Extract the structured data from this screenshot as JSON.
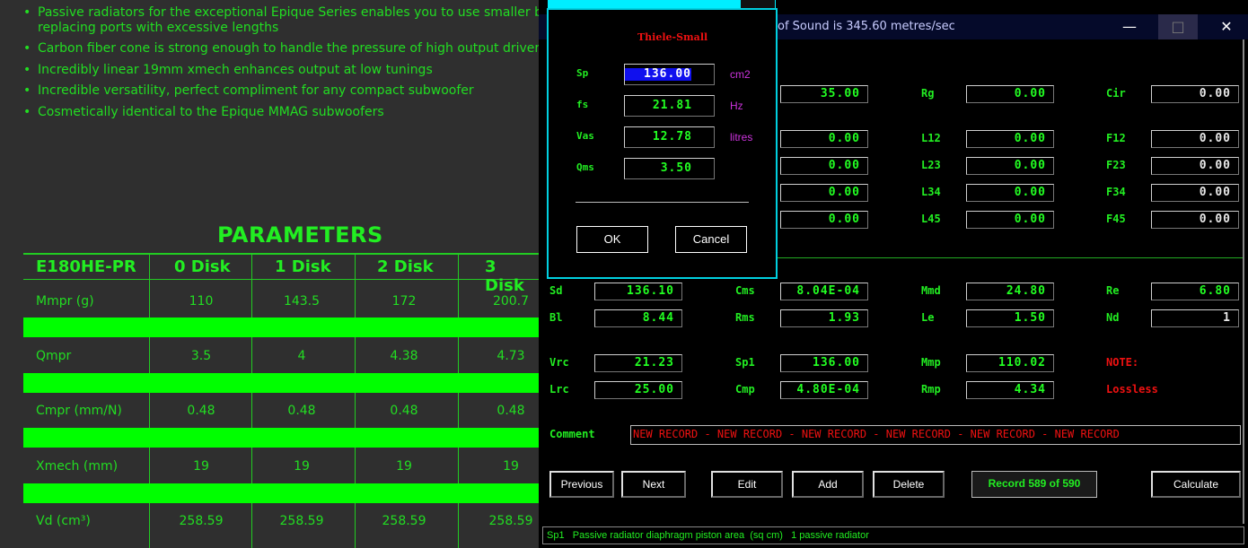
{
  "web": {
    "bullets": [
      "Passive radiators for the exceptional Epique Series enables you to use smaller boxes",
      "replacing ports with excessive lengths",
      "Carbon fiber cone is strong enough to handle the pressure of high output drivers",
      "Incredibly linear 19mm xmech enhances output at low tunings",
      "Incredible versatility, perfect compliment for any compact subwoofer",
      "Cosmetically identical to the Epique MMAG subwoofers"
    ],
    "bullet_char": "•",
    "params_title": "PARAMETERS",
    "headers": [
      "E180HE-PR",
      "0 Disk",
      "1 Disk",
      "2 Disk",
      "3 Disk"
    ],
    "rows": [
      {
        "label": "Mmpr (g)",
        "values": [
          "110",
          "143.5",
          "172",
          "200.7"
        ]
      },
      {
        "label": "Qmpr",
        "values": [
          "3.5",
          "4",
          "4.38",
          "4.73"
        ]
      },
      {
        "label": "Cmpr (mm/N)",
        "values": [
          "0.48",
          "0.48",
          "0.48",
          "0.48"
        ]
      },
      {
        "label": "Xmech (mm)",
        "values": [
          "19",
          "19",
          "19",
          "19"
        ]
      },
      {
        "label": "Vd (cm³)",
        "values": [
          "258.59",
          "258.59",
          "258.59",
          "258.59"
        ]
      }
    ]
  },
  "window": {
    "title": "of Sound is 345.60 metres/sec",
    "min_icon": "—",
    "max_icon": "□",
    "close_icon": "✕",
    "fields": {
      "top_col2": "35.00",
      "col2_r1": "0.00",
      "col2_r2": "0.00",
      "col2_r3": "0.00",
      "col2_r4": "0.00",
      "Rg_label": "Rg",
      "Rg": "0.00",
      "Cir_label": "Cir",
      "Cir": "0.00",
      "L12_label": "L12",
      "L12": "0.00",
      "L23_label": "L23",
      "L23": "0.00",
      "L34_label": "L34",
      "L34": "0.00",
      "L45_label": "L45",
      "L45": "0.00",
      "F12_label": "F12",
      "F12": "0.00",
      "F23_label": "F23",
      "F23": "0.00",
      "F34_label": "F34",
      "F34": "0.00",
      "F45_label": "F45",
      "F45": "0.00",
      "Sd_label": "Sd",
      "Sd": "136.10",
      "Cms_label": "Cms",
      "Cms": "8.04E-04",
      "Mmd_label": "Mmd",
      "Mmd": "24.80",
      "Re_label": "Re",
      "Re": "6.80",
      "Bl_label": "Bl",
      "Bl": "8.44",
      "Rms_label": "Rms",
      "Rms": "1.93",
      "Le_label": "Le",
      "Le": "1.50",
      "Nd_label": "Nd",
      "Nd": "1",
      "Vrc_label": "Vrc",
      "Vrc": "21.23",
      "Sp1_label": "Sp1",
      "Sp1": "136.00",
      "Mmp_label": "Mmp",
      "Mmp": "110.02",
      "Lrc_label": "Lrc",
      "Lrc": "25.00",
      "Cmp_label": "Cmp",
      "Cmp": "4.80E-04",
      "Rmp_label": "Rmp",
      "Rmp": "4.34"
    },
    "note_label": "NOTE:",
    "note_value": "Lossless",
    "comment_label": "Comment",
    "comment_value": "NEW RECORD - NEW RECORD - NEW RECORD - NEW RECORD - NEW RECORD - NEW RECORD",
    "buttons": {
      "previous": "Previous",
      "next": "Next",
      "edit": "Edit",
      "add": "Add",
      "delete": "Delete",
      "calculate": "Calculate"
    },
    "record": "Record 589 of 590",
    "status": "Sp1   Passive radiator diaphragm piston area  (sq cm)   1 passive radiator"
  },
  "dialog": {
    "title": "Thiele-Small",
    "fields": [
      {
        "label": "Sp",
        "value": "136.00",
        "unit": "cm2"
      },
      {
        "label": "fs",
        "value": "21.81",
        "unit": "Hz"
      },
      {
        "label": "Vas",
        "value": "12.78",
        "unit": "litres"
      },
      {
        "label": "Qms",
        "value": "3.50",
        "unit": ""
      }
    ],
    "ok": "OK",
    "cancel": "Cancel"
  }
}
